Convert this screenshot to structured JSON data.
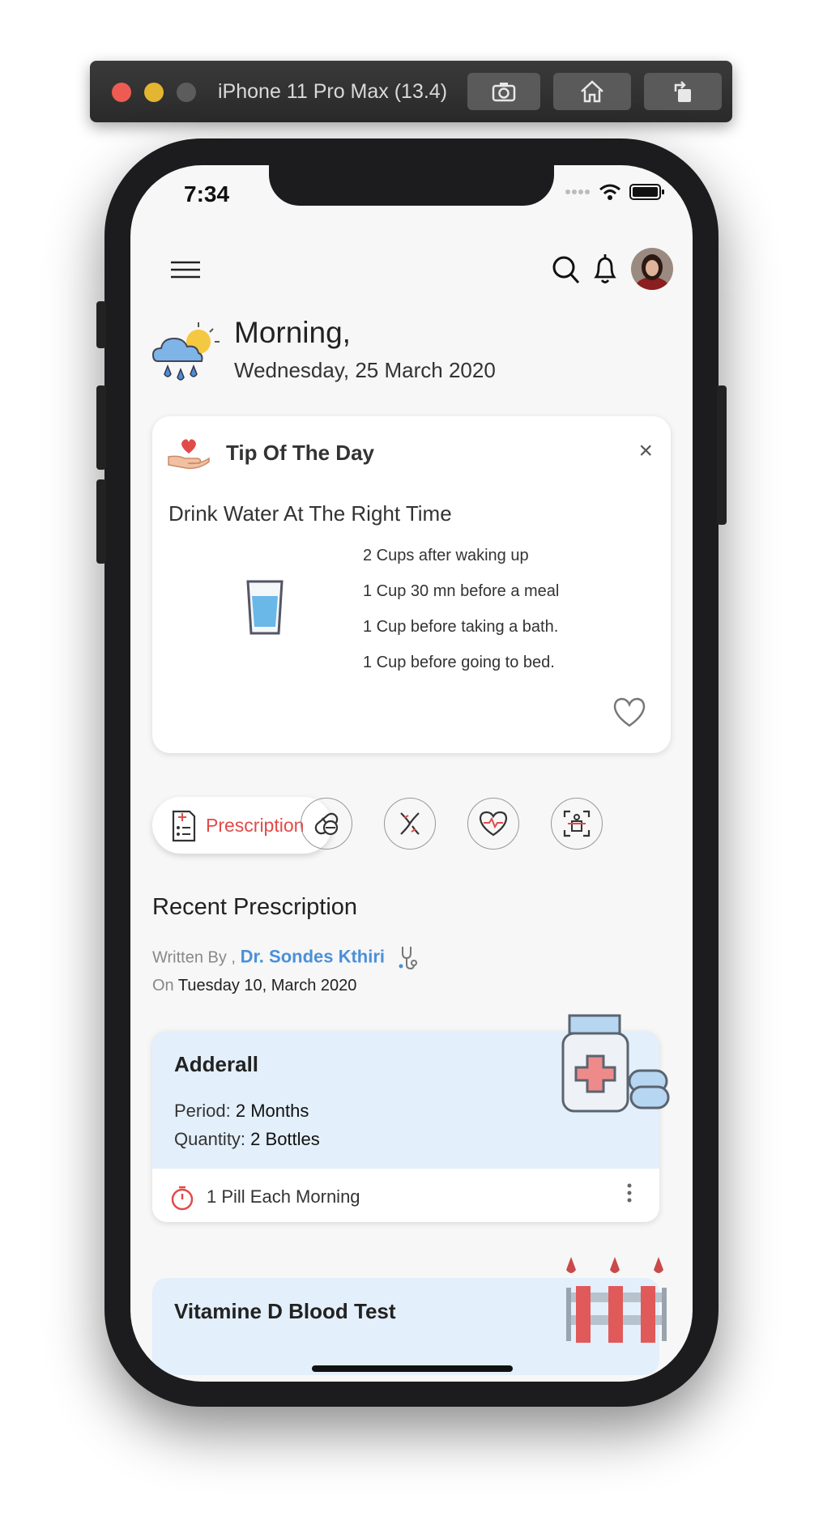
{
  "simulator": {
    "title": "iPhone 11 Pro Max (13.4)",
    "buttons": [
      {
        "icon": "camera-icon"
      },
      {
        "icon": "home-icon"
      },
      {
        "icon": "rotate-icon"
      }
    ]
  },
  "status_bar": {
    "time": "7:34"
  },
  "header": {
    "menu_icon": "hamburger-icon",
    "search_icon": "search-icon",
    "notification_icon": "bell-icon",
    "avatar": "user-avatar"
  },
  "greeting": {
    "title": "Morning,",
    "date": "Wednesday, 25 March 2020",
    "weather_icon": "rain-sun-icon"
  },
  "tip": {
    "title": "Tip Of The Day",
    "close": "×",
    "subtitle": "Drink Water At The Right Time",
    "items": [
      "2 Cups after waking up",
      "1 Cup 30 mn before a meal",
      "1 Cup before taking a bath.",
      "1 Cup before going to bed."
    ]
  },
  "categories": {
    "active_label": "Prescription",
    "icons": [
      "pill-icon",
      "dna-icon",
      "heart-pulse-icon",
      "body-scan-icon"
    ]
  },
  "recent": {
    "title": "Recent Prescription",
    "written_by_prefix": "Written By ,",
    "doctor": "Dr. Sondes Kthiri",
    "on_prefix": "On",
    "date": "Tuesday 10, March 2020"
  },
  "medication": {
    "name": "Adderall",
    "period_label": "Period:",
    "period_value": "2 Months",
    "quantity_label": "Quantity:",
    "quantity_value": "2 Bottles",
    "dosage": "1 Pill Each Morning"
  },
  "test": {
    "name": "Vitamine D Blood Test"
  },
  "colors": {
    "accent_red": "#e24a4a",
    "doctor_blue": "#4a90d9",
    "card_blue": "#e3effa"
  }
}
